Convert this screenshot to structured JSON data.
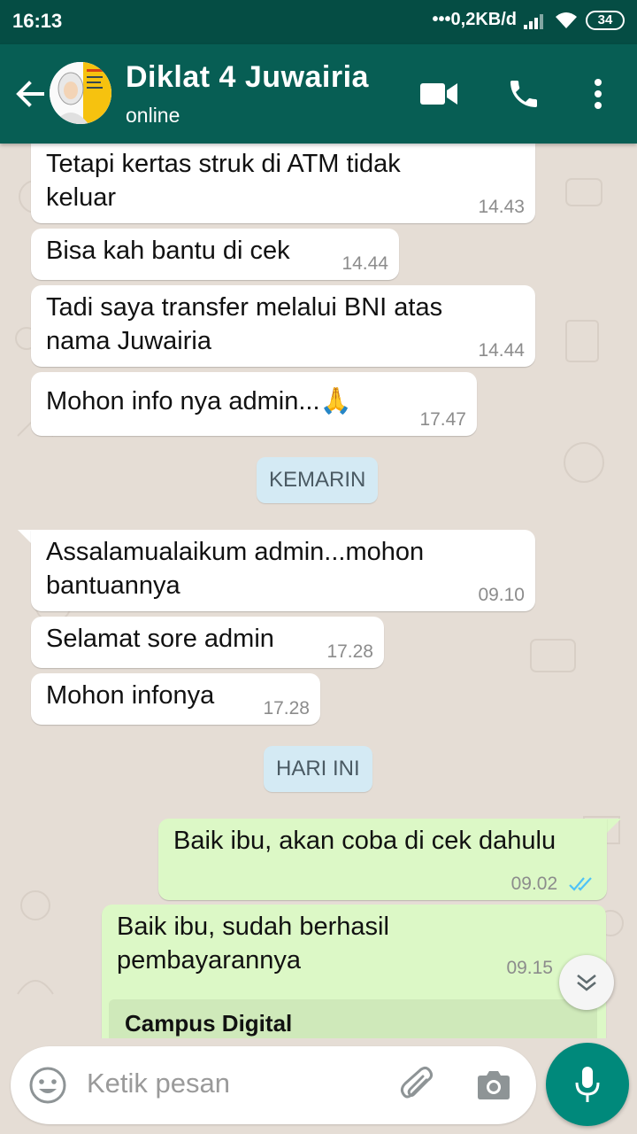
{
  "status_bar": {
    "time": "16:13",
    "network_speed": "0,2KB/d",
    "battery": "34"
  },
  "header": {
    "title": "Diklat 4 Juwairia",
    "subtitle": "online"
  },
  "colors": {
    "header": "#075e54",
    "status_bar": "#054d44",
    "incoming_bubble": "#ffffff",
    "outgoing_bubble": "#dcf8c6",
    "accent": "#00897b",
    "read_ticks": "#4fc3f7"
  },
  "messages": [
    {
      "direction": "in",
      "text": "Tetapi kertas struk di ATM tidak keluar",
      "time": "14.43"
    },
    {
      "direction": "in",
      "text": "Bisa kah bantu di cek",
      "time": "14.44"
    },
    {
      "direction": "in",
      "text": "Tadi saya transfer melalui BNI atas nama Juwairia",
      "time": "14.44"
    },
    {
      "direction": "in",
      "text": "Mohon info nya admin...🙏",
      "time": "17.47"
    },
    {
      "direction": "in",
      "text": "Assalamualaikum admin...mohon bantuannya",
      "time": "09.10"
    },
    {
      "direction": "in",
      "text": "Selamat sore admin",
      "time": "17.28"
    },
    {
      "direction": "in",
      "text": "Mohon infonya",
      "time": "17.28"
    },
    {
      "direction": "out",
      "text": "Baik ibu, akan coba di cek dahulu",
      "time": "09.02",
      "status": "read"
    },
    {
      "direction": "out",
      "text": "Baik ibu, sudah berhasil pembayarannya",
      "time": "09.15",
      "status": "read"
    }
  ],
  "day_separators": [
    "KEMARIN",
    "HARI INI"
  ],
  "quoted_preview": {
    "title": "Campus Digital"
  },
  "composer": {
    "placeholder": "Ketik pesan"
  },
  "icons": [
    "back-arrow-icon",
    "video-call-icon",
    "phone-icon",
    "more-vert-icon",
    "emoji-icon",
    "attach-icon",
    "camera-icon",
    "mic-icon",
    "scroll-down-icon",
    "read-ticks-icon",
    "wifi-icon",
    "signal-icon"
  ]
}
